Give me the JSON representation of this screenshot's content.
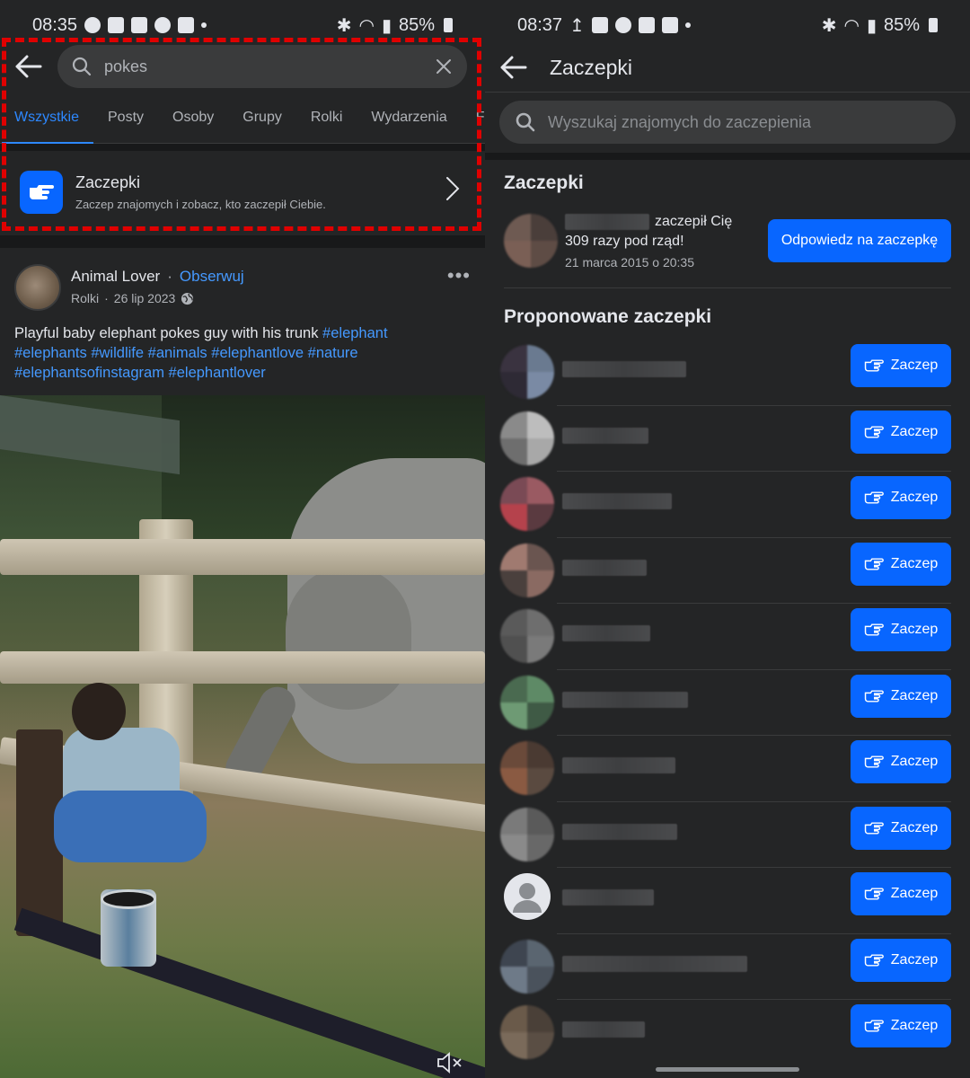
{
  "left": {
    "status": {
      "time": "08:35",
      "battery": "85%"
    },
    "search": {
      "query": "pokes"
    },
    "tabs": [
      "Wszystkie",
      "Posty",
      "Osoby",
      "Grupy",
      "Rolki",
      "Wydarzenia",
      "F"
    ],
    "feature": {
      "title": "Zaczepki",
      "subtitle": "Zaczep znajomych i zobacz, kto zaczepił Ciebie."
    },
    "post": {
      "author": "Animal Lover",
      "separator": "·",
      "follow": "Obserwuj",
      "meta_source": "Rolki",
      "meta_sep": "·",
      "meta_date": "26 lip 2023",
      "text_plain": "Playful baby elephant pokes guy with his trunk ",
      "tags": [
        "#elephant",
        "#elephants",
        "#wildlife",
        "#animals",
        "#elephantlove",
        "#nature",
        "#elephantsofinstagram",
        "#elephantlover"
      ]
    },
    "icons": {
      "back": "arrow-left-icon",
      "search": "magnifier-icon",
      "clear": "close-icon",
      "feature": "poke-hand-icon",
      "chevron": "chevron-right-icon",
      "more": "more-icon",
      "public": "globe-icon",
      "mute": "muted-speaker-icon"
    },
    "accent": "#2d88ff",
    "highlight_color": "#e00000"
  },
  "right": {
    "status": {
      "time": "08:37",
      "battery": "85%"
    },
    "title": "Zaczepki",
    "search_placeholder": "Wyszukaj znajomych do zaczepienia",
    "section_pokes": "Zaczepki",
    "poke": {
      "poked_you": "zaczepił Cię",
      "streak": "309 razy pod rząd!",
      "date": "21 marca 2015 o 20:35",
      "reply": "Odpowiedz na zaczepkę"
    },
    "section_suggested": "Proponowane zaczepki",
    "suggested_button": "Zaczep",
    "suggested_count": 11,
    "button_color": "#0866ff"
  }
}
